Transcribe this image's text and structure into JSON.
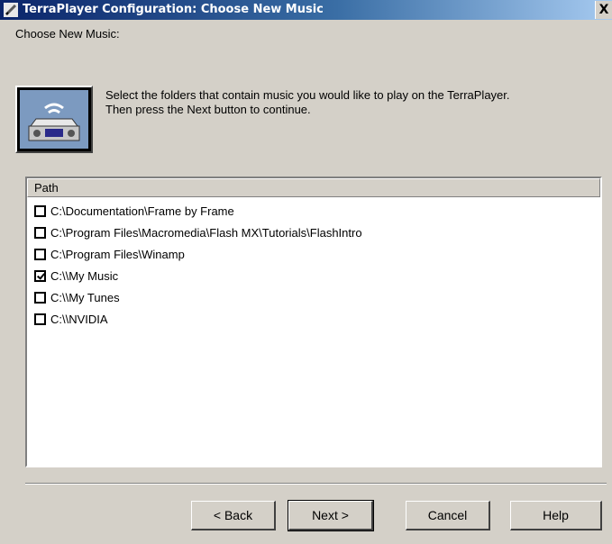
{
  "window": {
    "title": "TerraPlayer Configuration:  Choose New Music",
    "close_label": "X"
  },
  "section_label": "Choose New Music:",
  "instructions": {
    "line1": "Select the folders that contain music you would like to play on the TerraPlayer.",
    "line2": "Then press the Next button to continue."
  },
  "list": {
    "header": "Path",
    "items": [
      {
        "path": "C:\\Documentation\\Frame by Frame",
        "checked": false
      },
      {
        "path": "C:\\Program Files\\Macromedia\\Flash MX\\Tutorials\\FlashIntro",
        "checked": false
      },
      {
        "path": "C:\\Program Files\\Winamp",
        "checked": false
      },
      {
        "path": "C:\\\\My Music",
        "checked": true
      },
      {
        "path": "C:\\\\My Tunes",
        "checked": false
      },
      {
        "path": "C:\\\\NVIDIA",
        "checked": false
      }
    ]
  },
  "buttons": {
    "back": "< Back",
    "next": "Next >",
    "cancel": "Cancel",
    "help": "Help"
  },
  "icons": {
    "title": "pencil-icon",
    "app": "wireless-player-icon"
  },
  "colors": {
    "titlebar_start": "#0a246a",
    "titlebar_end": "#a6caf0",
    "dialog_bg": "#d4d0c8",
    "icon_bg": "#7c9ac0"
  }
}
